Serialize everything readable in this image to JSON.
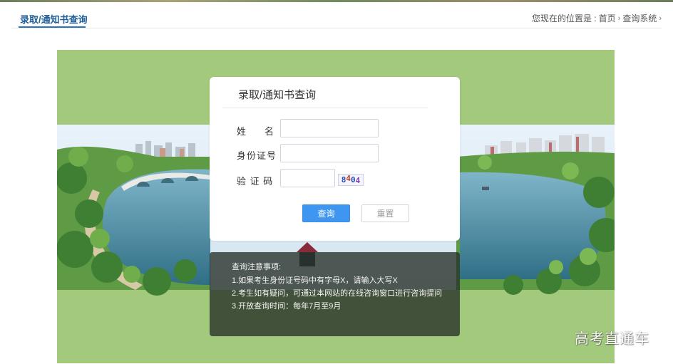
{
  "header": {
    "title": "录取/通知书查询",
    "breadcrumb": {
      "prefix": "您现在的位置是 :",
      "home": "首页",
      "current": "查询系统",
      "separator": "›"
    }
  },
  "form": {
    "title": "录取/通知书查询",
    "name_label_1": "姓",
    "name_label_2": "名",
    "id_label": "身份证号",
    "captcha_label": "验 证 码",
    "name_value": "",
    "id_value": "",
    "captcha_value": "",
    "captcha_digits": [
      "8",
      "4",
      "0",
      "4"
    ],
    "query_button": "查询",
    "reset_button": "重置"
  },
  "notice": {
    "title": "查询注意事项:",
    "items": [
      "1.如果考生身份证号码中有字母X，请输入大写X",
      "2.考生如有疑问，可通过本网站的在线咨询窗口进行咨询提问",
      "3.开放查询时间：每年7月至9月"
    ]
  },
  "watermark": "高考直通车",
  "colors": {
    "accent": "#2b73b8",
    "button_primary": "#3f96f0",
    "background_green": "#a3c97d"
  }
}
